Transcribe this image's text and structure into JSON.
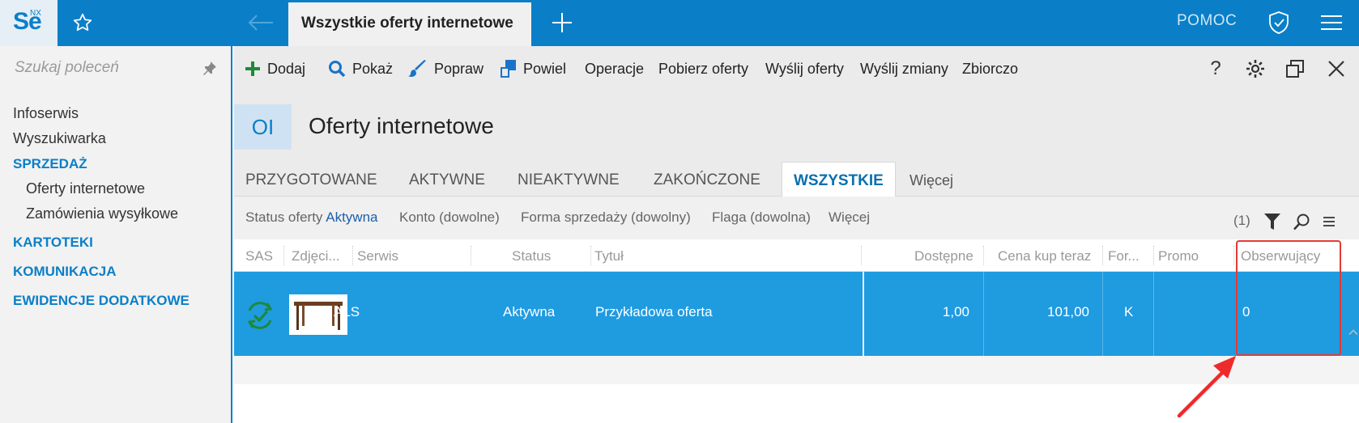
{
  "app": {
    "logo_text": "Se",
    "logo_sup": "NX",
    "active_tab_title": "Wszystkie oferty internetowe",
    "help_label": "POMOC"
  },
  "sidebar": {
    "search_placeholder": "Szukaj poleceń",
    "items": [
      {
        "label": "Infoserwis",
        "kind": "plain"
      },
      {
        "label": "Wyszukiwarka",
        "kind": "plain"
      },
      {
        "label": "SPRZEDAŻ",
        "kind": "section"
      },
      {
        "label": "Oferty internetowe",
        "kind": "sub"
      },
      {
        "label": "Zamówienia wysyłkowe",
        "kind": "sub"
      },
      {
        "label": "KARTOTEKI",
        "kind": "section"
      },
      {
        "label": "KOMUNIKACJA",
        "kind": "section"
      },
      {
        "label": "EWIDENCJE DODATKOWE",
        "kind": "section"
      }
    ]
  },
  "toolbar": {
    "add": "Dodaj",
    "show": "Pokaż",
    "edit": "Popraw",
    "duplicate": "Powiel",
    "operations": "Operacje",
    "fetch_offers": "Pobierz oferty",
    "send_offers": "Wyślij oferty",
    "send_changes": "Wyślij zmiany",
    "summary": "Zbiorczo",
    "help_glyph": "?"
  },
  "header": {
    "badge": "OI",
    "title": "Oferty internetowe"
  },
  "tabs": {
    "prepared": "PRZYGOTOWANE",
    "active": "AKTYWNE",
    "inactive": "NIEAKTYWNE",
    "finished": "ZAKOŃCZONE",
    "all": "WSZYSTKIE",
    "more": "Więcej"
  },
  "filters": {
    "status_label": "Status oferty",
    "status_value": "Aktywna",
    "account": "Konto (dowolne)",
    "sale_form": "Forma sprzedaży (dowolny)",
    "flag": "Flaga (dowolna)",
    "more": "Więcej",
    "count": "(1)"
  },
  "grid": {
    "columns": {
      "sas": "SAS",
      "photo": "Zdjęci...",
      "service": "Serwis",
      "status": "Status",
      "title": "Tytuł",
      "available": "Dostępne",
      "buy_now_price": "Cena kup teraz",
      "form": "For...",
      "promo": "Promo",
      "watchers": "Obserwujący"
    },
    "rows": [
      {
        "service": "ALS",
        "status": "Aktywna",
        "title": "Przykładowa oferta",
        "available": "1,00",
        "buy_now_price": "101,00",
        "form": "K",
        "promo": "",
        "watchers": "0"
      }
    ]
  },
  "colors": {
    "accent": "#0a7fc8",
    "selected_row": "#1f9be0",
    "annotation": "#e53935"
  }
}
